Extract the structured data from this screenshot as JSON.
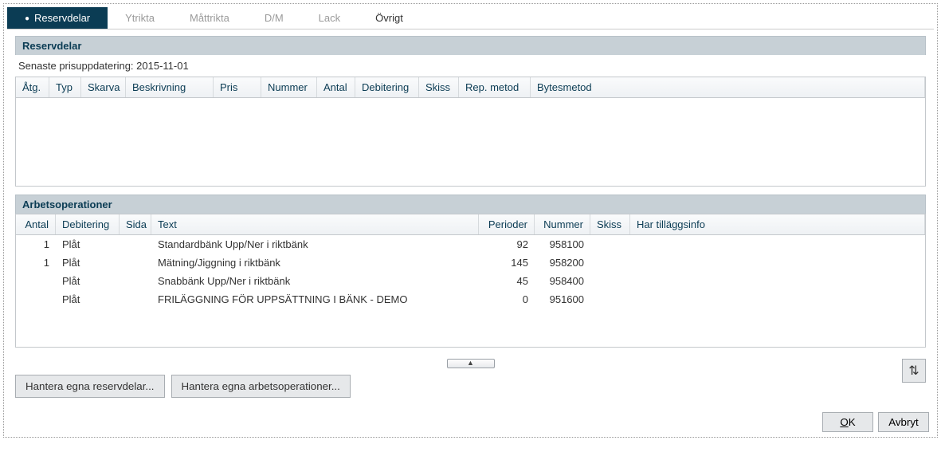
{
  "tabs": {
    "reservdelar": "Reservdelar",
    "ytrikta": "Ytrikta",
    "mattrikta": "Måttrikta",
    "dm": "D/M",
    "lack": "Lack",
    "ovrigt": "Övrigt"
  },
  "parts_panel": {
    "title": "Reservdelar",
    "last_price_update": "Senaste prisuppdatering: 2015-11-01",
    "columns": {
      "atg": "Åtg.",
      "typ": "Typ",
      "skarva": "Skarva",
      "beskrivning": "Beskrivning",
      "pris": "Pris",
      "nummer": "Nummer",
      "antal": "Antal",
      "debitering": "Debitering",
      "skiss": "Skiss",
      "rep_metod": "Rep. metod",
      "bytesmetod": "Bytesmetod"
    }
  },
  "ops_panel": {
    "title": "Arbetsoperationer",
    "columns": {
      "antal": "Antal",
      "debitering": "Debitering",
      "sida": "Sida",
      "text": "Text",
      "perioder": "Perioder",
      "nummer": "Nummer",
      "skiss": "Skiss",
      "har_tillaggsinfo": "Har tilläggsinfo"
    },
    "rows": [
      {
        "antal": "1",
        "debitering": "Plåt",
        "sida": "",
        "text": "Standardbänk  Upp/Ner i riktbänk",
        "perioder": "92",
        "nummer": "958100",
        "skiss": "",
        "info": ""
      },
      {
        "antal": "1",
        "debitering": "Plåt",
        "sida": "",
        "text": "Mätning/Jiggning i riktbänk",
        "perioder": "145",
        "nummer": "958200",
        "skiss": "",
        "info": ""
      },
      {
        "antal": "",
        "debitering": "Plåt",
        "sida": "",
        "text": "Snabbänk Upp/Ner i riktbänk",
        "perioder": "45",
        "nummer": "958400",
        "skiss": "",
        "info": ""
      },
      {
        "antal": "",
        "debitering": "Plåt",
        "sida": "",
        "text": "FRILÄGGNING FÖR UPPSÄTTNING I BÄNK - DEMO",
        "perioder": "0",
        "nummer": "951600",
        "skiss": "",
        "info": ""
      }
    ]
  },
  "buttons": {
    "manage_parts": "Hantera egna reservdelar...",
    "manage_ops": "Hantera egna arbetsoperationer...",
    "ok": "OK",
    "cancel": "Avbryt"
  },
  "icons": {
    "collapse": "▲",
    "sort": "⇅"
  }
}
